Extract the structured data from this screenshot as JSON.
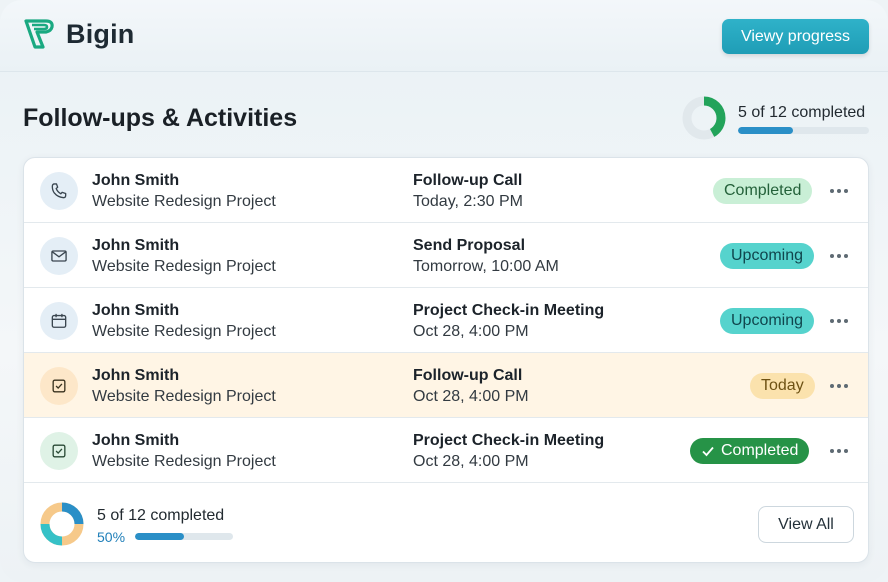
{
  "header": {
    "brand_name": "Bigin",
    "progress_button_label": "Viewy progress"
  },
  "colors": {
    "accent": "#1f9db6",
    "completed_badge": "#c9efd6",
    "upcoming_badge": "#56d3cd",
    "today_badge": "#fbe2ad",
    "completed_solid_badge": "#269347",
    "highlight_row": "#fff5e5"
  },
  "main": {
    "title": "Follow-ups & Activities",
    "summary_text": "5 of 12 completed",
    "summary_fraction": 0.42
  },
  "activities": [
    {
      "icon": "phone-icon",
      "name": "John Smith",
      "project": "Website Redesign Project",
      "title": "Follow-up Call",
      "time": "Today, 2:30 PM",
      "status": "Completed",
      "status_style": "completed"
    },
    {
      "icon": "mail-icon",
      "name": "John Smith",
      "project": "Website Redesign Project",
      "title": "Send Proposal",
      "time": "Tomorrow, 10:00 AM",
      "status": "Upcoming",
      "status_style": "upcoming"
    },
    {
      "icon": "calendar-icon",
      "name": "John Smith",
      "project": "Website Redesign Project",
      "title": "Project Check-in Meeting",
      "time": "Oct 28, 4:00 PM",
      "status": "Upcoming",
      "status_style": "upcoming"
    },
    {
      "icon": "checkbox-icon",
      "name": "John Smith",
      "project": "Website Redesign Project",
      "title": "Follow-up Call",
      "time": "Oct 28, 4:00 PM",
      "status": "Today",
      "status_style": "today"
    },
    {
      "icon": "checkbox-icon",
      "name": "John Smith",
      "project": "Website Redesign Project",
      "title": "Project Check-in Meeting",
      "time": "Oct 28, 4:00 PM",
      "status": "Completed",
      "status_style": "completed-solid"
    }
  ],
  "footer": {
    "summary_text": "5 of 12 completed",
    "percent_label": "50%",
    "percent_value": 0.5,
    "view_all_label": "View All"
  }
}
